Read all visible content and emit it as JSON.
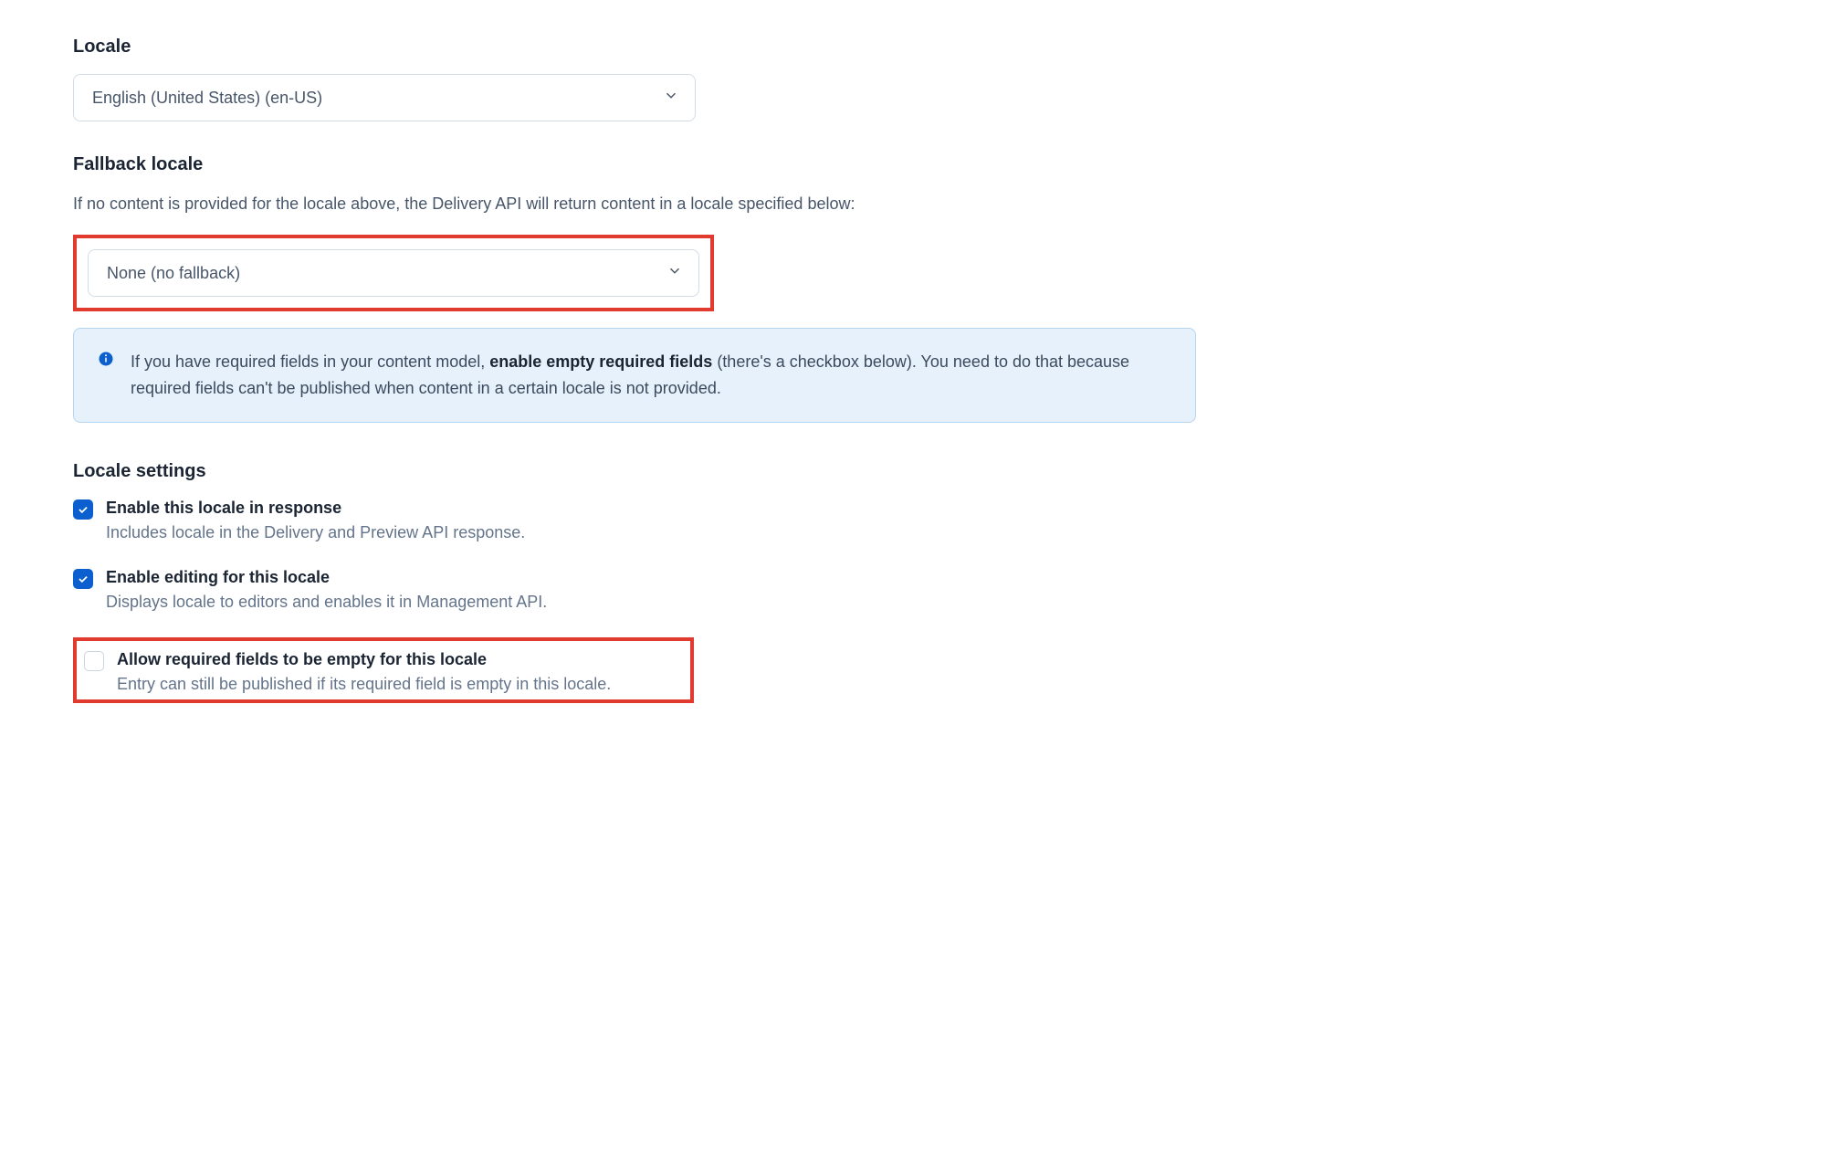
{
  "locale": {
    "label": "Locale",
    "selected": "English (United States) (en-US)"
  },
  "fallback": {
    "label": "Fallback locale",
    "description": "If no content is provided for the locale above, the Delivery API will return content in a locale specified below:",
    "selected": "None (no fallback)"
  },
  "note": {
    "text_before": "If you have required fields in your content model, ",
    "text_bold": "enable empty required fields",
    "text_after": " (there's a checkbox below). You need to do that because required fields can't be published when content in a certain locale is not provided."
  },
  "settings": {
    "label": "Locale settings",
    "items": [
      {
        "title": "Enable this locale in response",
        "description": "Includes locale in the Delivery and Preview API response.",
        "checked": true
      },
      {
        "title": "Enable editing for this locale",
        "description": "Displays locale to editors and enables it in Management API.",
        "checked": true
      },
      {
        "title": "Allow required fields to be empty for this locale",
        "description": "Entry can still be published if its required field is empty in this locale.",
        "checked": false
      }
    ]
  },
  "colors": {
    "highlight_border": "#e03b2e",
    "info_bg": "#e7f1fb",
    "checkbox_checked": "#0b5fce"
  }
}
